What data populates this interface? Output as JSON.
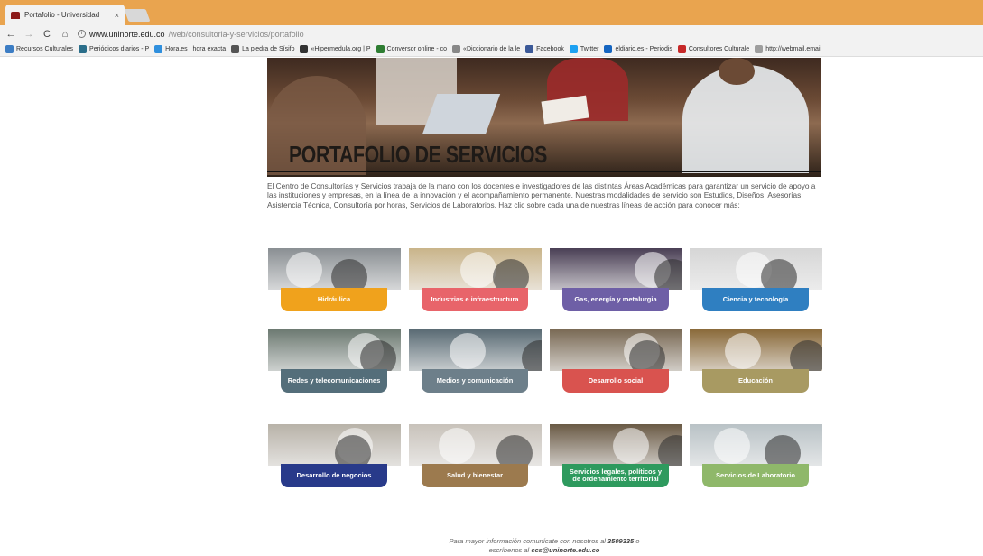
{
  "browser": {
    "tab_title": "Portafolio - Universidad",
    "tab_close": "×",
    "url_host": "www.uninorte.edu.co",
    "url_path": "/web/consultoria-y-servicios/portafolio",
    "bookmarks": [
      {
        "label": "Recursos Culturales",
        "color": "#3c7dc4"
      },
      {
        "label": "Periódicos diarios - P",
        "color": "#2a6e8a"
      },
      {
        "label": "Hora.es : hora exacta",
        "color": "#2f8fdd"
      },
      {
        "label": "La piedra de Sísifo",
        "color": "#555555"
      },
      {
        "label": "«Hipermedula.org | P",
        "color": "#333333"
      },
      {
        "label": "Conversor online - co",
        "color": "#2e7d32"
      },
      {
        "label": "«Diccionario de la le",
        "color": "#888888"
      },
      {
        "label": "Facebook",
        "color": "#3b5998"
      },
      {
        "label": "Twitter",
        "color": "#1da1f2"
      },
      {
        "label": "eldiario.es - Periodis",
        "color": "#1565c0"
      },
      {
        "label": "Consultores Culturale",
        "color": "#c62828"
      },
      {
        "label": "http://webmail.email",
        "color": "#9e9e9e"
      }
    ]
  },
  "page": {
    "hero_title": "PORTAFOLIO DE SERVICIOS",
    "intro": "El Centro de Consultorías y Servicios trabaja de la mano con los docentes e investigadores de las distintas Áreas Académicas para garantizar un servicio de apoyo a las instituciones y empresas, en la línea de la innovación y el acompañamiento permanente. Nuestras modalidades de servicio son Estudios, Diseños, Asesorías, Asistencia Técnica, Consultoría por horas, Servicios de Laboratorios. Haz clic sobre cada una de nuestras líneas de acción para conocer más:",
    "services": [
      {
        "label": "Hidráulica",
        "color": "#f0a21c",
        "photo": "#8a8f93"
      },
      {
        "label": "Industrias e infraestructura",
        "color": "#e8646a",
        "photo": "#c9b48a"
      },
      {
        "label": "Gas, energía y metalurgia",
        "color": "#6e5fa6",
        "photo": "#4a3f55"
      },
      {
        "label": "Ciencia y tecnología",
        "color": "#2f7fc1",
        "photo": "#d6d6d6"
      },
      {
        "label": "Redes y telecomunicaciones",
        "color": "#546e7a",
        "photo": "#6d7a72"
      },
      {
        "label": "Medios y comunicación",
        "color": "#6d7f8a",
        "photo": "#5a6b74"
      },
      {
        "label": "Desarrollo social",
        "color": "#d9534f",
        "photo": "#7a6a55"
      },
      {
        "label": "Educación",
        "color": "#a89a62",
        "photo": "#8a6a3a"
      },
      {
        "label": "Desarrollo de negocios",
        "color": "#283a8a",
        "photo": "#b8b2a8"
      },
      {
        "label": "Salud y bienestar",
        "color": "#9c7a4e",
        "photo": "#c8c2ba"
      },
      {
        "label": "Servicios legales, políticos y de ordenamiento territorial",
        "color": "#2e9a5e",
        "photo": "#6a5a45"
      },
      {
        "label": "Servicios de Laboratorio",
        "color": "#8fb86a",
        "photo": "#b9c2c6"
      }
    ],
    "footer_line1_pre": "Para mayor información comunícate con nosotros al ",
    "footer_phone": "3509335",
    "footer_line1_post": " o",
    "footer_line2_pre": "escríbenos al ",
    "footer_email": "ccs@uninorte.edu.co"
  }
}
